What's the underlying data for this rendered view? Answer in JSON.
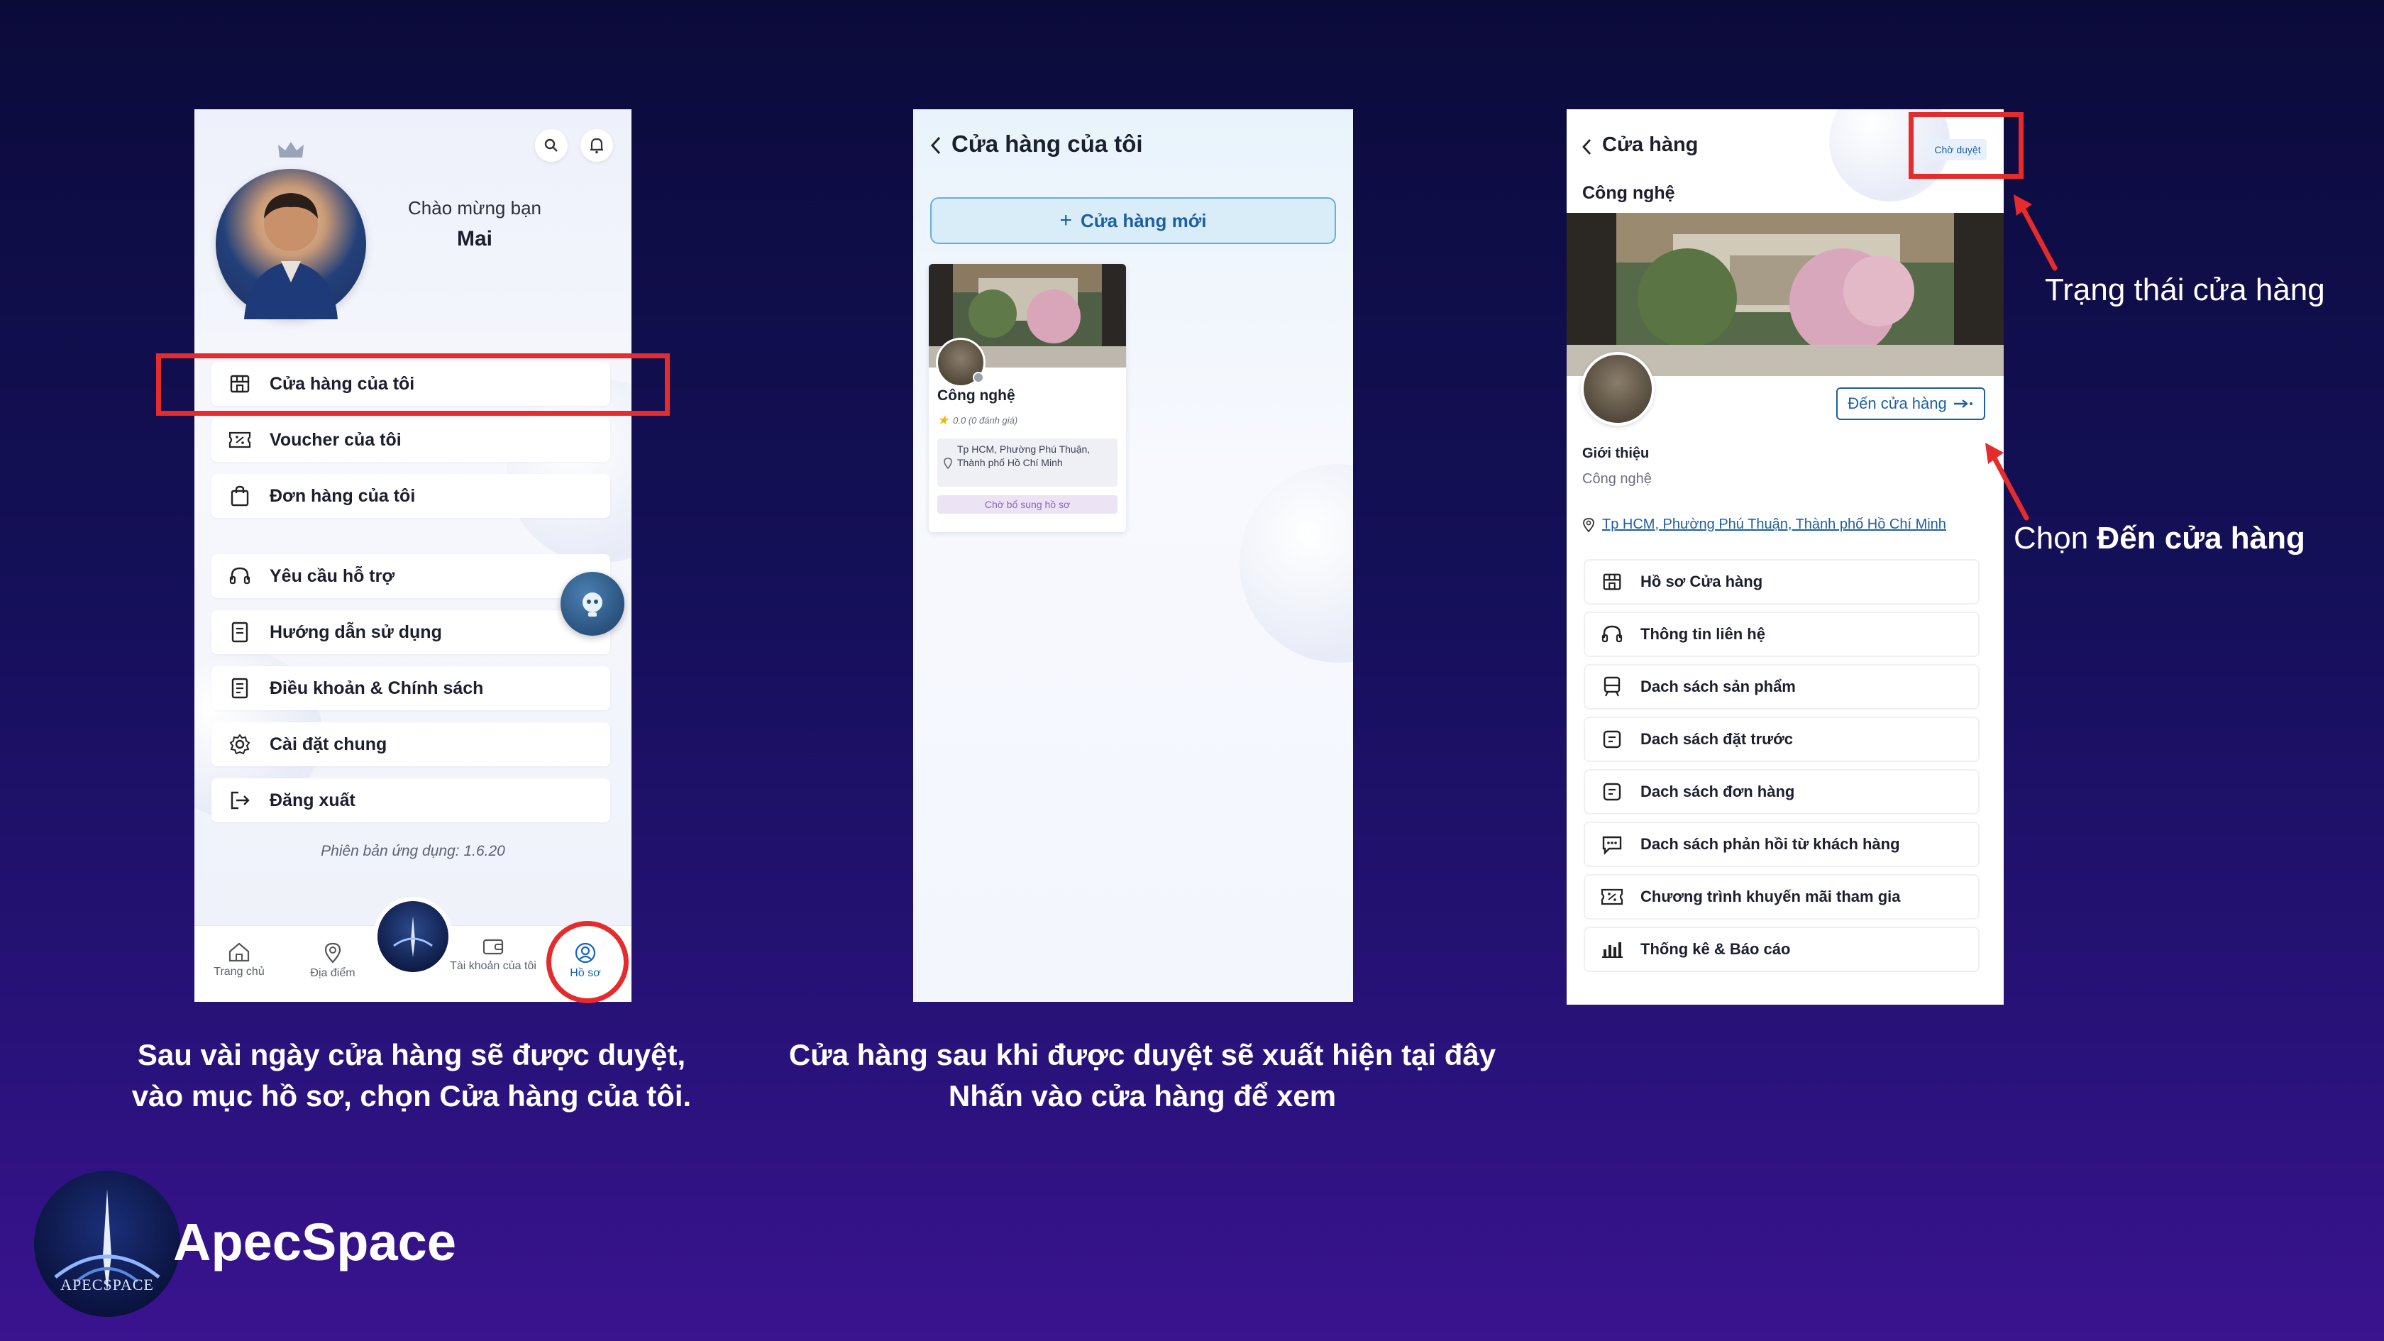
{
  "colors": {
    "accent": "#1565c0",
    "highlight": "#e52b2b",
    "background": "#0b0b3a"
  },
  "screen1": {
    "greeting": "Chào mừng bạn",
    "username": "Mai",
    "menu_group1": [
      {
        "label": "Cửa hàng của tôi",
        "icon": "store-icon"
      },
      {
        "label": "Voucher của tôi",
        "icon": "voucher-icon"
      },
      {
        "label": "Đơn hàng của tôi",
        "icon": "bag-icon"
      }
    ],
    "menu_group2": [
      {
        "label": "Yêu cầu hỗ trợ",
        "icon": "headset-icon"
      },
      {
        "label": "Hướng dẫn sử dụng",
        "icon": "guide-icon"
      },
      {
        "label": "Điều khoản & Chính sách",
        "icon": "document-icon"
      },
      {
        "label": "Cài đặt chung",
        "icon": "gear-icon"
      },
      {
        "label": "Đăng xuất",
        "icon": "logout-icon"
      }
    ],
    "version": "Phiên bản ứng dụng: 1.6.20",
    "tabs": [
      {
        "label": "Trang chủ",
        "icon": "home-icon"
      },
      {
        "label": "Địa điểm",
        "icon": "location-icon"
      },
      {
        "label": "Tài khoản của tôi",
        "icon": "wallet-icon"
      },
      {
        "label": "Hồ sơ",
        "icon": "profile-icon"
      }
    ]
  },
  "screen2": {
    "title": "Cửa hàng của tôi",
    "new_store_button": "Cửa hàng mới",
    "store_card": {
      "name": "Công nghệ",
      "rating": "0.0 (0 đánh giá)",
      "address": "Tp HCM, Phường Phú Thuận, Thành phố Hồ Chí Minh",
      "status": "Chờ bổ sung hồ sơ"
    }
  },
  "screen3": {
    "title": "Cửa hàng",
    "status_badge": "Chờ duyệt",
    "store_name": "Công nghệ",
    "go_to_store_button": "Đến cửa hàng",
    "intro_label": "Giới thiệu",
    "intro_value": "Công nghệ",
    "address_link": "Tp HCM, Phường Phú Thuận, Thành phố Hồ Chí Minh",
    "list": [
      {
        "label": "Hồ sơ Cửa hàng",
        "icon": "store-icon"
      },
      {
        "label": "Thông tin liên hệ",
        "icon": "headset-icon"
      },
      {
        "label": "Dach sách sản phẩm",
        "icon": "product-icon"
      },
      {
        "label": "Dach sách đặt trước",
        "icon": "list-icon"
      },
      {
        "label": "Dach sách đơn hàng",
        "icon": "list-icon"
      },
      {
        "label": "Dach sách phản hồi từ khách hàng",
        "icon": "chat-icon"
      },
      {
        "label": "Chương trình khuyến mãi tham gia",
        "icon": "voucher-icon"
      },
      {
        "label": "Thống kê & Báo cáo",
        "icon": "chart-icon"
      }
    ]
  },
  "annotations": {
    "store_status": "Trạng thái cửa hàng",
    "choose_prefix": "Chọn ",
    "choose_bold": "Đến cửa hàng"
  },
  "captions": {
    "caption1_line1": "Sau vài ngày cửa hàng sẽ được duyệt,",
    "caption1_line2": "vào mục hồ sơ, chọn Cửa hàng của tôi.",
    "caption2_line1": "Cửa hàng sau khi được duyệt sẽ xuất hiện tại đây",
    "caption2_line2": "Nhấn vào cửa hàng để xem"
  },
  "brand": {
    "name": "ApecSpace",
    "logo_text": "APECSPACE"
  }
}
